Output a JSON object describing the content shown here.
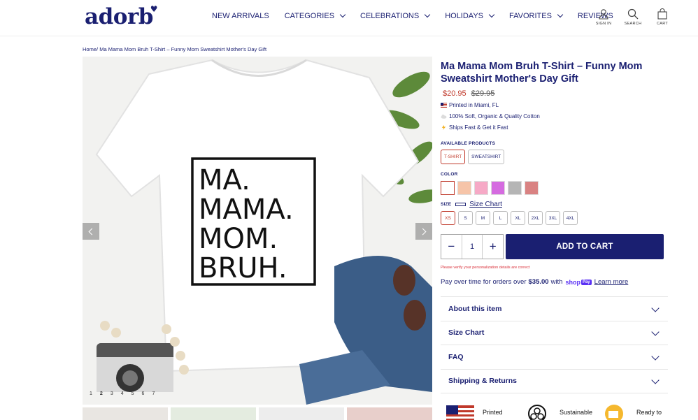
{
  "header": {
    "logo": "adorb",
    "nav": [
      {
        "label": "NEW ARRIVALS",
        "dropdown": false
      },
      {
        "label": "CATEGORIES",
        "dropdown": true
      },
      {
        "label": "CELEBRATIONS",
        "dropdown": true
      },
      {
        "label": "HOLIDAYS",
        "dropdown": true
      },
      {
        "label": "FAVORITES",
        "dropdown": true
      },
      {
        "label": "REVIEWS",
        "dropdown": false
      }
    ],
    "icons": {
      "signin": "SIGN IN",
      "search": "SEARCH",
      "cart": "CART"
    }
  },
  "breadcrumb": {
    "home": "Home",
    "separator": "/",
    "current": "Ma Mama Mom Bruh T-Shirt – Funny Mom Sweatshirt Mother's Day Gift"
  },
  "gallery": {
    "shirt_text": [
      "MA.",
      "MAMA.",
      "MOM.",
      "BRUH."
    ],
    "dots": [
      "1",
      "2",
      "3",
      "4",
      "5",
      "6",
      "7"
    ],
    "active_dot": "2"
  },
  "product": {
    "title": "Ma Mama Mom Bruh T-Shirt – Funny Mom Sweatshirt Mother's Day Gift",
    "price_sale": "$20.95",
    "price_original": "$29.95",
    "features": [
      {
        "icon": "us-flag-icon",
        "text": "Printed in Miami, FL"
      },
      {
        "icon": "cloud-icon",
        "text": "100% Soft, Organic & Quality Cotton"
      },
      {
        "icon": "lightning-icon",
        "text": "Ships Fast & Get it Fast"
      }
    ],
    "available_label": "AVAILABLE PRODUCTS",
    "products": [
      "T-SHIRT",
      "SWEATSHIRT"
    ],
    "selected_product": "T-SHIRT",
    "color_label": "COLOR",
    "colors": [
      "#ffffff",
      "#f6c4a8",
      "#f6a9c6",
      "#d56be0",
      "#b5b5b5",
      "#d98282"
    ],
    "size_label": "SIZE",
    "size_chart_label": "Size Chart",
    "sizes": [
      "XS",
      "S",
      "M",
      "L",
      "XL",
      "2XL",
      "3XL",
      "4XL"
    ],
    "selected_size": "XS",
    "quantity": "1",
    "qty_minus": "−",
    "qty_plus": "+",
    "add_to_cart": "ADD TO CART",
    "warning": "Please verify your personalization details are correct",
    "pay_over_text": "Pay over time for orders over",
    "pay_over_amount": "$35.00",
    "pay_over_with": "with",
    "shop_pay": "shop",
    "shop_pay_badge": "Pay",
    "learn_more": "Learn more",
    "accordion": [
      "About this item",
      "Size Chart",
      "FAQ",
      "Shipping & Returns"
    ]
  },
  "badges": [
    {
      "icon": "us-flag-icon",
      "text": "Printed"
    },
    {
      "icon": "recycle-icon",
      "text": "Sustainable"
    },
    {
      "icon": "shipping-icon",
      "text": "Ready to"
    }
  ],
  "colors": {
    "brand": "#1a1f71",
    "sale": "#c0392b",
    "warning": "#d9303a"
  }
}
